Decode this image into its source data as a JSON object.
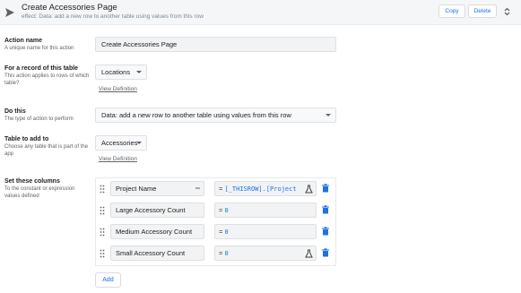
{
  "header": {
    "title": "Create Accessories Page",
    "subtitle": "effect: Data: add a new row to another table using values from this row",
    "copy_label": "Copy",
    "delete_label": "Delete",
    "icon": "send-icon"
  },
  "action_name": {
    "label": "Action name",
    "hint": "A unique name for this action",
    "value": "Create Accessories Page"
  },
  "for_record": {
    "label": "For a record of this table",
    "hint": "This action applies to rows of which table?",
    "value": "Locations",
    "link": "View Definition"
  },
  "do_this": {
    "label": "Do this",
    "hint": "The type of action to perform",
    "value": "Data: add a new row to another table using values from this row"
  },
  "table_to_add": {
    "label": "Table to add to",
    "hint": "Choose any table that is part of the app",
    "value": "Accessories",
    "link": "View Definition"
  },
  "set_columns": {
    "label": "Set these columns",
    "hint": "To the constant or expression values defined",
    "rows": [
      {
        "column": "Project Name",
        "eq": "=",
        "expression": "[_THISROW].[Project"
      },
      {
        "column": "Large Accessory Count",
        "eq": "=",
        "expression": "0"
      },
      {
        "column": "Medium Accessory Count",
        "eq": "=",
        "expression": "0"
      },
      {
        "column": "Small Accessory Count",
        "eq": "=",
        "expression": "0"
      }
    ],
    "add_label": "Add"
  }
}
